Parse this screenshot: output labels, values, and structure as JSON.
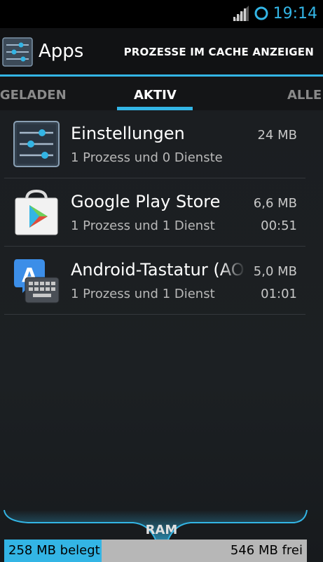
{
  "status_bar": {
    "time": "19:14",
    "icons": [
      "signal-icon",
      "sync-icon"
    ],
    "accent_color": "#33b5e5"
  },
  "action_bar": {
    "title": "Apps",
    "icon": "settings-sliders-icon",
    "action_label": "PROZESSE IM CACHE ANZEIGEN"
  },
  "tabs": [
    {
      "label": "HERUNTERGELADEN",
      "visible_text": "RGELADEN"
    },
    {
      "label": "AKTIV",
      "selected": true
    },
    {
      "label": "ALLE",
      "visible_text": "ALLE"
    }
  ],
  "apps": [
    {
      "name": "Einstellungen",
      "sub": "1 Prozess und 0 Dienste",
      "size": "24 MB",
      "time": "",
      "icon": "settings-sliders-icon"
    },
    {
      "name": "Google Play Store",
      "sub": "1 Prozess und 1 Dienst",
      "size": "6,6 MB",
      "time": "00:51",
      "icon": "play-store-icon"
    },
    {
      "name": "Android-Tastatur (AOSP)",
      "sub": "1 Prozess und 1 Dienst",
      "size": "5,0 MB",
      "time": "01:01",
      "icon": "keyboard-icon"
    }
  ],
  "ram": {
    "label": "RAM",
    "used_text": "258 MB belegt",
    "free_text": "546 MB frei",
    "used_fraction": 0.321
  }
}
